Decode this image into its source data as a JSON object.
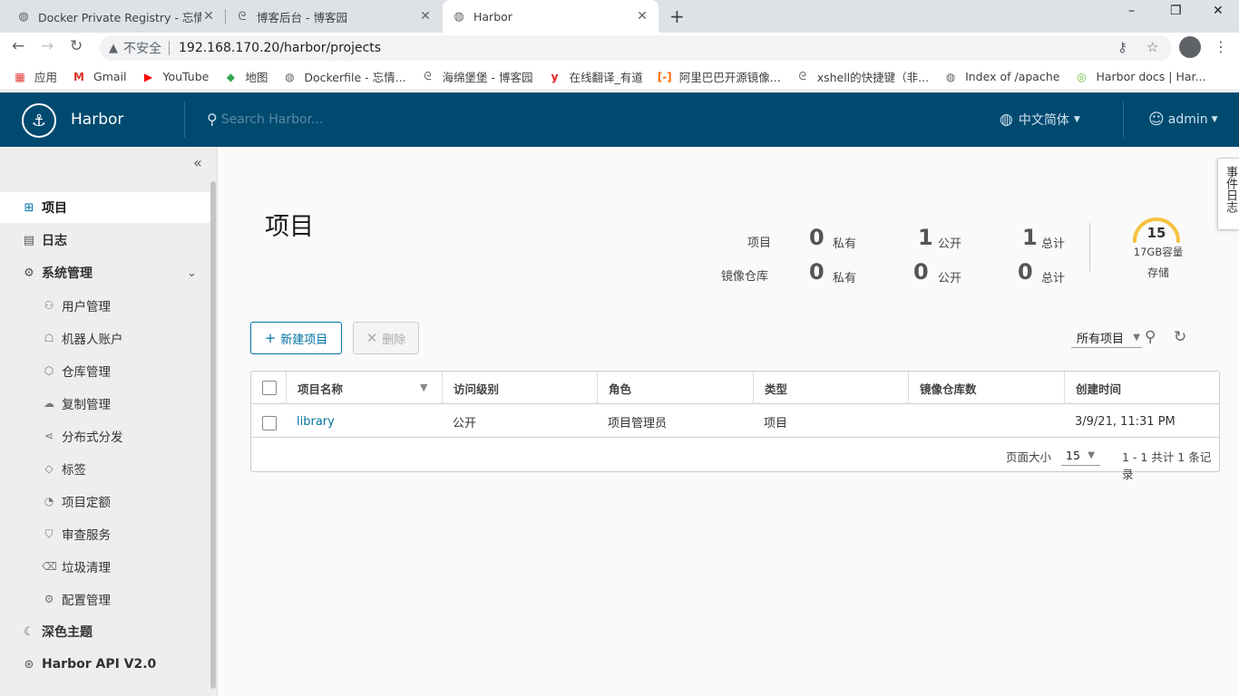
{
  "browser": {
    "tabs": [
      {
        "title": "Docker Private Registry - 忘情",
        "icon": "globe-icon"
      },
      {
        "title": "博客后台 - 博客园",
        "icon": "cnblogs-icon"
      },
      {
        "title": "Harbor",
        "icon": "globe-icon"
      }
    ],
    "new_tab": "+",
    "window_controls": [
      "–",
      "❐",
      "✕"
    ],
    "security_text": "不安全",
    "url": "192.168.170.20/harbor/projects",
    "bookmarks": [
      {
        "label": "应用",
        "icon": "apps-icon",
        "color": "#e53935"
      },
      {
        "label": "Gmail",
        "icon": "gmail-icon",
        "color": "#d93025"
      },
      {
        "label": "YouTube",
        "icon": "youtube-icon",
        "color": "#ff0000"
      },
      {
        "label": "地图",
        "icon": "maps-icon",
        "color": "#34a853"
      },
      {
        "label": "Dockerfile - 忘情...",
        "icon": "globe-icon",
        "color": "#5f6368"
      },
      {
        "label": "海绵堡堡 - 博客园",
        "icon": "cnblogs-icon",
        "color": "#5f6368"
      },
      {
        "label": "在线翻译_有道",
        "icon": "youdao-icon",
        "color": "#e91e1e"
      },
      {
        "label": "阿里巴巴开源镜像...",
        "icon": "aliyun-icon",
        "color": "#ff6a00"
      },
      {
        "label": "xshell的快捷键（非...",
        "icon": "cnblogs-icon",
        "color": "#5f6368"
      },
      {
        "label": "Index of /apache",
        "icon": "globe-icon",
        "color": "#5f6368"
      },
      {
        "label": "Harbor docs | Har...",
        "icon": "harbor-icon",
        "color": "#60b932"
      }
    ]
  },
  "header": {
    "brand": "Harbor",
    "search_placeholder": "Search Harbor...",
    "language": "中文简体",
    "user": "admin",
    "color": "#004a70"
  },
  "sidebar": {
    "items": [
      {
        "label": "项目",
        "icon": "projects-icon"
      },
      {
        "label": "日志",
        "icon": "logs-icon"
      },
      {
        "label": "系统管理",
        "icon": "admin-icon"
      }
    ],
    "sub_items": [
      {
        "label": "用户管理",
        "icon": "users-icon"
      },
      {
        "label": "机器人账户",
        "icon": "robot-icon"
      },
      {
        "label": "仓库管理",
        "icon": "registry-icon"
      },
      {
        "label": "复制管理",
        "icon": "replication-icon"
      },
      {
        "label": "分布式分发",
        "icon": "distribution-icon"
      },
      {
        "label": "标签",
        "icon": "tag-icon"
      },
      {
        "label": "项目定额",
        "icon": "quota-icon"
      },
      {
        "label": "审查服务",
        "icon": "shield-icon"
      },
      {
        "label": "垃圾清理",
        "icon": "trash-icon"
      },
      {
        "label": "配置管理",
        "icon": "gear-icon"
      }
    ],
    "bottom": [
      {
        "label": "深色主题",
        "icon": "moon-icon"
      },
      {
        "label": "Harbor API V2.0",
        "icon": "api-icon"
      }
    ]
  },
  "main": {
    "title": "项目",
    "stats": {
      "projects_label": "项目",
      "repos_label": "镜像仓库",
      "private": "私有",
      "public": "公开",
      "total": "总计",
      "projects": {
        "private": "0",
        "public": "1",
        "total": "1"
      },
      "repos": {
        "private": "0",
        "public": "0",
        "total": "0"
      }
    },
    "storage": {
      "value": "15",
      "capacity": "17GB容量",
      "label": "存储"
    },
    "new_button": "新建项目",
    "delete_button": "删除",
    "filter": "所有项目",
    "table": {
      "columns": [
        "项目名称",
        "访问级别",
        "角色",
        "类型",
        "镜像仓库数",
        "创建时间"
      ],
      "rows": [
        {
          "name": "library",
          "access": "公开",
          "role": "项目管理员",
          "type": "项目",
          "repos": "",
          "created": "3/9/21, 11:31 PM"
        }
      ],
      "page_size_label": "页面大小",
      "page_size": "15",
      "page_info": "1 - 1 共计 1 条记录"
    },
    "event_log": "事件日志"
  }
}
